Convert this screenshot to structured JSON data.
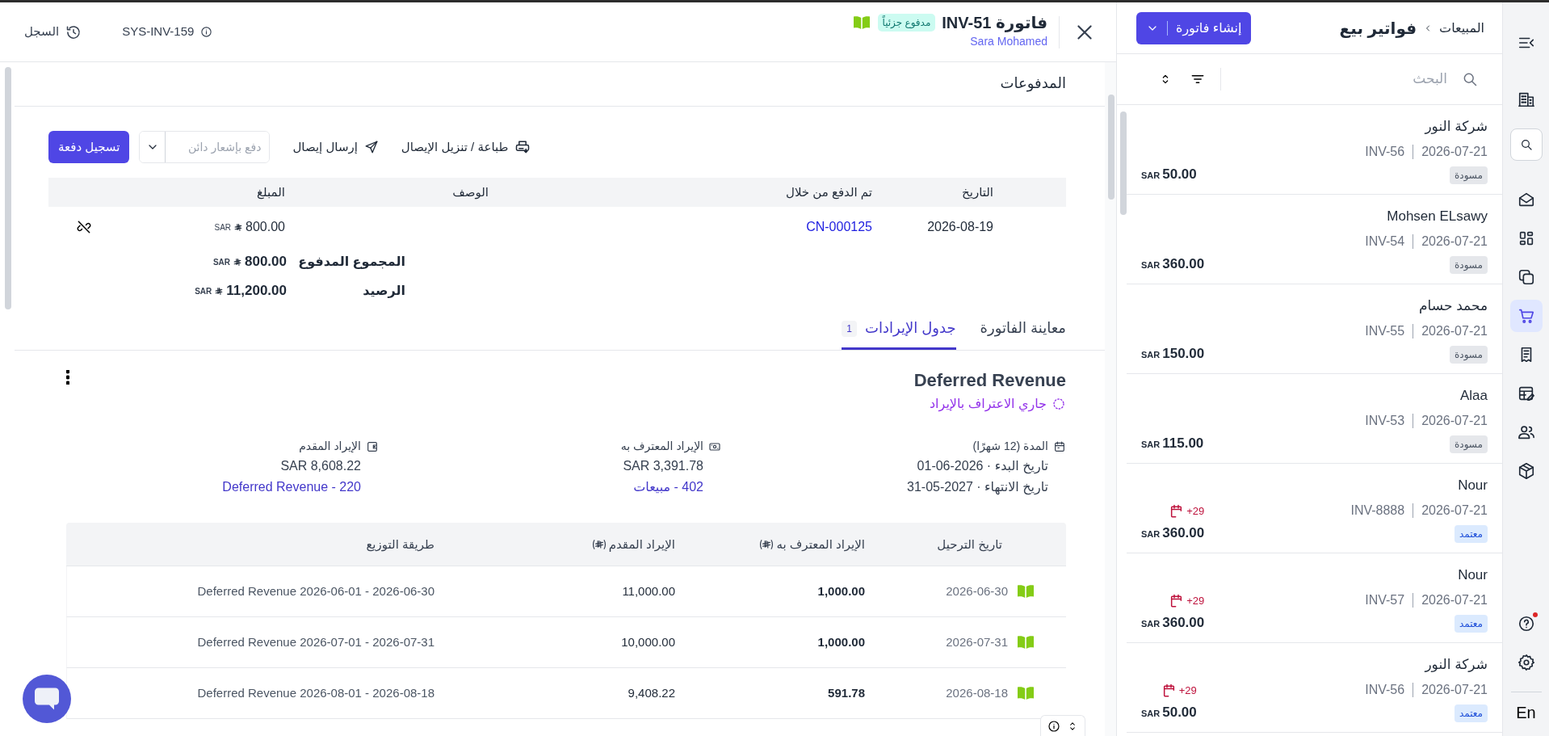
{
  "header": {
    "title": "فاتورة INV-51",
    "status": "مدفوع جزئياً",
    "posted": true,
    "customer": "Sara Mohamed",
    "reference": "SYS-INV-159",
    "history": "السجل"
  },
  "payments": {
    "title": "المدفوعات",
    "print": "طباعة / تنزيل الإيصال",
    "send": "إرسال إيصال",
    "credit_field": {
      "placeholder": "دفع بإشعار دائن"
    },
    "record": "تسجيل دفعة",
    "columns": [
      "التاريخ",
      "تم الدفع من خلال",
      "الوصف",
      "المبلغ"
    ],
    "rows": [
      {
        "date": "2026-08-19",
        "via": "CN-000125",
        "amount": "800.00",
        "currency": "SAR"
      }
    ],
    "totals": [
      {
        "label": "المجموع المدفوع",
        "amount": "800.00",
        "currency": "SAR"
      },
      {
        "label": "الرصيد",
        "amount": "11,200.00",
        "currency": "SAR"
      }
    ]
  },
  "tabs": [
    {
      "label": "معاينة الفاتورة",
      "selected": false
    },
    {
      "label": "جدول الإيرادات",
      "selected": true,
      "count": "1"
    }
  ],
  "schedule": {
    "title": "Deferred Revenue",
    "status": "جاري الاعتراف بالإيراد",
    "stats": [
      {
        "kind": "period",
        "label": "المدة (12 شهرًا)",
        "lines": [
          "تاريخ البدء · 2026-06-01",
          "تاريخ الانتهاء · 2027-05-31"
        ]
      },
      {
        "kind": "recognized",
        "label": "الإيراد المعترف به",
        "value": "SAR 3,391.78",
        "account": "402 - مبيعات"
      },
      {
        "kind": "deferred",
        "label": "الإيراد المقدم",
        "value": "SAR 8,608.22",
        "account": "Deferred Revenue - 220"
      }
    ],
    "table": {
      "columns": [
        {
          "label": "تاريخ الترحيل",
          "currency": false
        },
        {
          "label": "الإيراد المعترف به",
          "currency": true
        },
        {
          "label": "الإيراد المقدم",
          "currency": true
        },
        {
          "label": "طريقة التوزيع",
          "currency": false
        }
      ],
      "rows": [
        {
          "posted": true,
          "date": "2026-06-30",
          "recognized": "1,000.00",
          "deferred": "11,000.00",
          "method": "Deferred Revenue 2026-06-01 - 2026-06-30"
        },
        {
          "posted": true,
          "date": "2026-07-31",
          "recognized": "1,000.00",
          "deferred": "10,000.00",
          "method": "Deferred Revenue 2026-07-01 - 2026-07-31"
        },
        {
          "posted": true,
          "date": "2026-08-18",
          "recognized": "591.78",
          "deferred": "9,408.22",
          "method": "Deferred Revenue 2026-08-01 - 2026-08-18"
        }
      ]
    }
  },
  "invoice_list": {
    "breadcrumb": [
      "المبيعات",
      "فواتير بيع"
    ],
    "create": "إنشاء فاتورة",
    "search": {
      "placeholder": "البحث"
    },
    "items": [
      {
        "name": "شركة النور",
        "date": "2026-07-21",
        "number": "INV-56",
        "status": "مسودة",
        "kind": "draft",
        "amount": "50.00",
        "currency": "SAR"
      },
      {
        "name": "Mohsen ELsawy",
        "date": "2026-07-21",
        "number": "INV-54",
        "status": "مسودة",
        "kind": "draft",
        "amount": "360.00",
        "currency": "SAR"
      },
      {
        "name": "محمد حسام",
        "date": "2026-07-21",
        "number": "INV-55",
        "status": "مسودة",
        "kind": "draft",
        "amount": "150.00",
        "currency": "SAR"
      },
      {
        "name": "Alaa",
        "date": "2026-07-21",
        "number": "INV-53",
        "status": "مسودة",
        "kind": "draft",
        "amount": "115.00",
        "currency": "SAR"
      },
      {
        "name": "Nour",
        "date": "2026-07-21",
        "number": "INV-8888",
        "status": "معتمد",
        "kind": "approved",
        "overdue": "+29",
        "amount": "360.00",
        "currency": "SAR"
      },
      {
        "name": "Nour",
        "date": "2026-07-21",
        "number": "INV-57",
        "status": "معتمد",
        "kind": "approved",
        "overdue": "+29",
        "amount": "360.00",
        "currency": "SAR"
      },
      {
        "name": "شركة النور",
        "date": "2026-07-21",
        "number": "INV-56",
        "status": "معتمد",
        "kind": "approved",
        "overdue": "+29",
        "amount": "50.00",
        "currency": "SAR"
      }
    ]
  },
  "sidebar": {
    "items": [
      {
        "selected": false
      },
      {
        "selected": false
      },
      {
        "selected": false
      },
      {
        "selected": false
      },
      {
        "selected": false
      },
      {
        "selected": true
      },
      {
        "selected": false
      },
      {
        "selected": false
      },
      {
        "selected": false
      },
      {
        "selected": false
      }
    ],
    "footer_items": [
      {
        "selected": false,
        "notification": true
      },
      {
        "selected": false,
        "notification": false
      }
    ],
    "language": "En"
  }
}
